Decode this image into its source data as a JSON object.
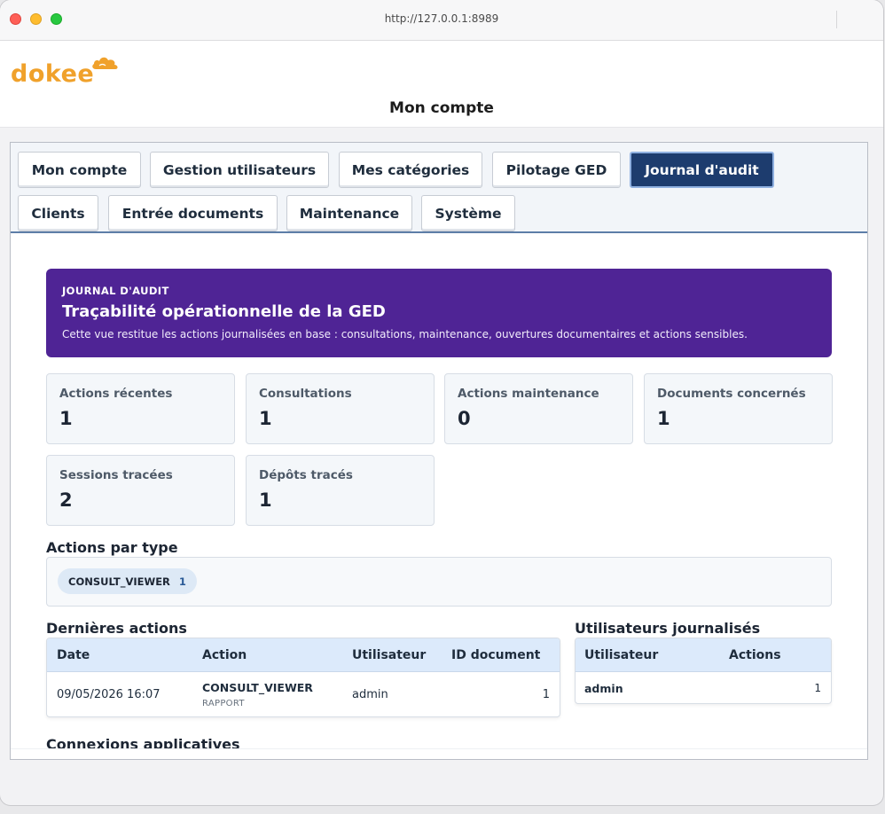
{
  "browser": {
    "url": "http://127.0.0.1:8989"
  },
  "header": {
    "logo_text": "dokee",
    "page_title": "Mon compte"
  },
  "tabs": [
    {
      "label": "Mon compte",
      "active": false
    },
    {
      "label": "Gestion utilisateurs",
      "active": false
    },
    {
      "label": "Mes catégories",
      "active": false
    },
    {
      "label": "Pilotage GED",
      "active": false
    },
    {
      "label": "Journal d'audit",
      "active": true
    },
    {
      "label": "Clients",
      "active": false
    },
    {
      "label": "Entrée documents",
      "active": false
    },
    {
      "label": "Maintenance",
      "active": false
    },
    {
      "label": "Système",
      "active": false
    }
  ],
  "banner": {
    "kicker": "JOURNAL D'AUDIT",
    "title": "Traçabilité opérationnelle de la GED",
    "description": "Cette vue restitue les actions journalisées en base : consultations, maintenance, ouvertures documentaires et actions sensibles."
  },
  "stats": [
    {
      "label": "Actions récentes",
      "value": "1"
    },
    {
      "label": "Consultations",
      "value": "1"
    },
    {
      "label": "Actions maintenance",
      "value": "0"
    },
    {
      "label": "Documents concernés",
      "value": "1"
    },
    {
      "label": "Sessions tracées",
      "value": "2"
    },
    {
      "label": "Dépôts tracés",
      "value": "1"
    }
  ],
  "actions_by_type": {
    "title": "Actions par type",
    "chips": [
      {
        "type": "CONSULT_VIEWER",
        "count": "1"
      }
    ]
  },
  "last_actions": {
    "title": "Dernières actions",
    "columns": [
      "Date",
      "Action",
      "Utilisateur",
      "ID document"
    ],
    "rows": [
      {
        "date": "09/05/2026 16:07",
        "action": "CONSULT_VIEWER",
        "action_sub": "RAPPORT",
        "user": "admin",
        "doc_id": "1"
      }
    ]
  },
  "logged_users": {
    "title": "Utilisateurs journalisés",
    "columns": [
      "Utilisateur",
      "Actions"
    ],
    "rows": [
      {
        "user": "admin",
        "count": "1"
      }
    ]
  },
  "app_connections": {
    "title": "Connexions applicatives"
  },
  "colors": {
    "accent": "#1d3c6e",
    "banner": "#4f2495",
    "logo": "#f0a12b",
    "table_header": "#dceafb"
  }
}
